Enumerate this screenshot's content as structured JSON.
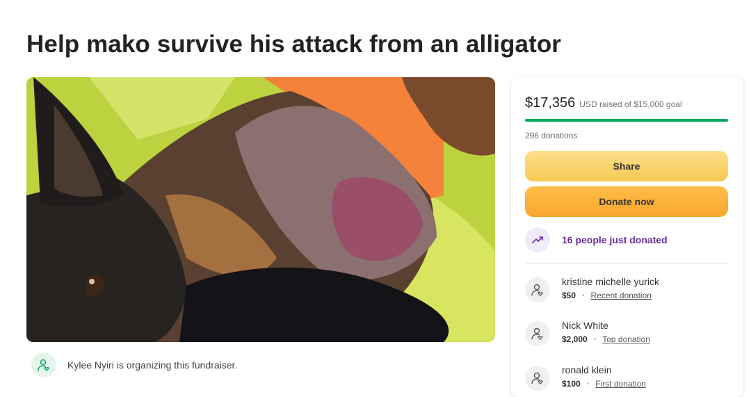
{
  "page": {
    "title": "Help mako survive his attack from an alligator"
  },
  "organizer": {
    "text": "Kylee Nyiri is organizing this fundraiser.",
    "icon": "user-heart-icon"
  },
  "card": {
    "raised_amount": "$17,356",
    "raised_suffix": "USD raised of $15,000 goal",
    "progress_fraction": 1.0,
    "donations_count": "296 donations",
    "share_label": "Share",
    "donate_label": "Donate now",
    "trend_text": "16 people just donated",
    "trend_icon": "trending-up-icon",
    "donors": [
      {
        "name": "kristine michelle yurick",
        "amount": "$50",
        "tag": "Recent donation"
      },
      {
        "name": "Nick White",
        "amount": "$2,000",
        "tag": "Top donation"
      },
      {
        "name": "ronald klein",
        "amount": "$100",
        "tag": "First donation"
      }
    ]
  },
  "colors": {
    "progress": "#02a95c",
    "share_button": "#f9cf66",
    "donate_button": "#f8a62c",
    "trend_text": "#6b2ba0"
  }
}
